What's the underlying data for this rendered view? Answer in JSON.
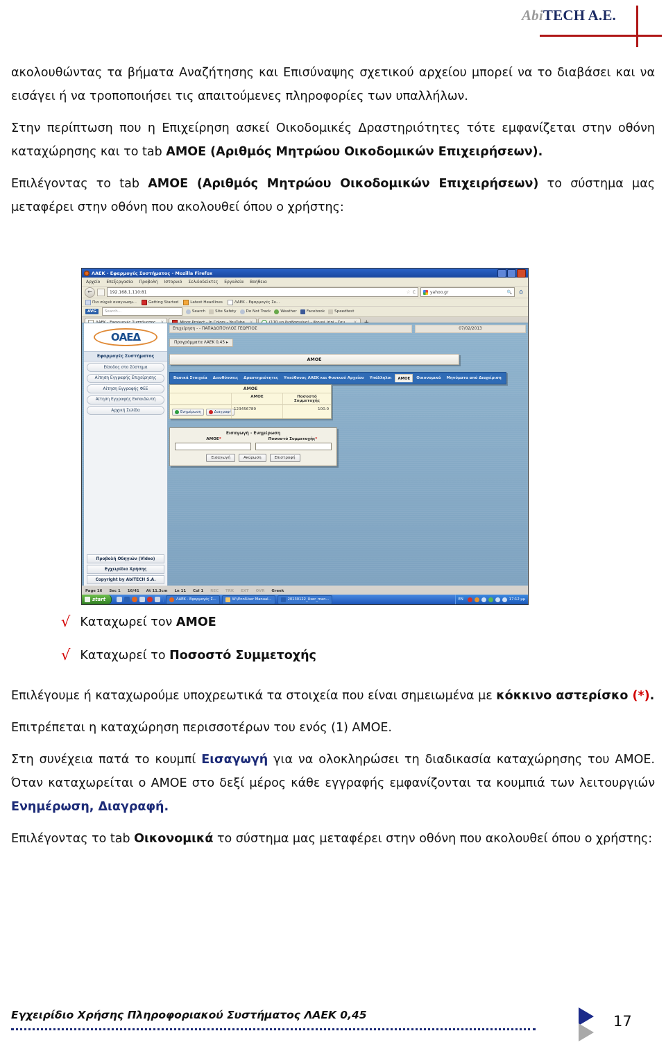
{
  "header": {
    "brand_abi": "Abi",
    "brand_tech": "TECH A.E."
  },
  "paragraphs": {
    "p1_a": "ακολουθώντας τα βήματα Αναζήτησης και Επισύναψης σχετικού αρχείου μπορεί να το διαβάσει και να εισάγει ή να τροποποιήσει τις απαιτούμενες πληροφορίες των υπαλλήλων.",
    "p2_a": " Στην περίπτωση που η Επιχείρηση ασκεί Οικοδομικές Δραστηριότητες τότε εμφανίζεται στην οθόνη καταχώρησης και το tab ",
    "p2_b": "ΑΜΟΕ (Αριθμός Μητρώου Οικοδομικών Επιχειρήσεων).",
    "p3_a": "Επιλέγοντας το tab ",
    "p3_b": "ΑΜΟΕ (Αριθμός Μητρώου Οικοδομικών Επιχειρήσεων)",
    "p3_c": " το σύστημα μας μεταφέρει στην οθόνη που ακολουθεί όπου ο χρήστης:",
    "p4_a": "Επιλέγουμε ή καταχωρούμε υποχρεωτικά τα στοιχεία που είναι σημειωμένα με ",
    "p4_b": "κόκκινο αστερίσκο ",
    "p4_c": "(*)",
    "p4_d": ".",
    "p5_a": "Επιτρέπεται η καταχώρηση περισσοτέρων του ενός (1) ΑΜΟΕ.",
    "p6_a": "Στη συνέχεια πατά το κουμπί ",
    "p6_b": "Εισαγωγή",
    "p6_c": " για να ολοκληρώσει τη διαδικασία καταχώρησης του ΑΜΟΕ. Όταν καταχωρείται ο ΑΜΟΕ στο δεξί μέρος κάθε εγγραφής εμφανίζονται τα κουμπιά των λειτουργιών ",
    "p6_d": "Ενημέρωση, Διαγραφή.",
    "p7_a": "Επιλέγοντας το tab ",
    "p7_b": "Οικονομικά",
    "p7_c": " το σύστημα μας μεταφέρει στην οθόνη που ακολουθεί όπου ο χρήστης:"
  },
  "bullets": [
    {
      "check": "√",
      "text_a": "Καταχωρεί τον ",
      "text_b": "ΑΜΟΕ"
    },
    {
      "check": "√",
      "text_a": "Καταχωρεί το ",
      "text_b": "Ποσοστό Συμμετοχής"
    }
  ],
  "screenshot": {
    "browser": {
      "window_title": "ΛΑΕΚ - Εφαρμογές Συστήματος - Mozilla Firefox",
      "menus": [
        "Αρχείο",
        "Επεξεργασία",
        "Προβολή",
        "Ιστορικό",
        "Σελιδοδείκτες",
        "Εργαλεία",
        "Βοήθεια"
      ],
      "url": "192.168.1.110:81",
      "reload_label": "C",
      "search_engine": "yahoo.gr",
      "bookmarks": [
        "Πιο σύχνά αναγνωσμ...",
        "Getting Started",
        "Latest Headlines",
        "ΛΑΕΚ - Εφαρμογές Συ..."
      ],
      "avg_label": "AVG",
      "avg_search_placeholder": "Search...",
      "avg_items": [
        "Search",
        "Site Safety",
        "Do Not Track",
        "Weather",
        "Facebook",
        "Speedtest"
      ],
      "tabs": [
        "ΛΑΕΚ - Εφαρμογές Συστήματος",
        "Minor Project - In Colors - YouTube",
        "(170 μη διαβασμένα) - ilkousi_irini - Γαμ...",
        "+"
      ]
    },
    "app": {
      "logo_text": "ΟΑΕΔ",
      "top_user": "Επιχείρηση - - ΠΑΠΑΔΟΠΟΥΛΟΣ ΓΕΩΡΓΙΟΣ",
      "top_date": "07/02/2013",
      "program_button": "Προγράμματα ΛΑΕΚ 0,45 ▸",
      "section_title": "ΑΜΟΕ",
      "sidebar": {
        "header": "Εφαρμογές Συστήματος",
        "items": [
          "Είσοδος στο Σύστημα",
          "Αίτηση Εγγραφής Επιχείρησης",
          "Αίτηση Εγγραφής ΦΕΕ",
          "Αίτηση Εγγραφής Εκπαιδευτή",
          "Αρχική Σελίδα"
        ],
        "footer": [
          "Προβολή Οδηγιών (Video)",
          "Εγχειρίδια Χρήσης",
          "Copyright by AbiTECH S.A."
        ]
      },
      "tabs": [
        {
          "label": "Βασικά Στοιχεία",
          "active": false
        },
        {
          "label": "Διευθύνσεις",
          "active": false
        },
        {
          "label": "Δραστηριότητες",
          "active": false
        },
        {
          "label": "Υπεύθυνος ΛΑΕΚ και Φυσικού Αρχείου",
          "active": false
        },
        {
          "label": "Υπάλληλοι",
          "active": false
        },
        {
          "label": "ΑΜΟΕ",
          "active": true
        },
        {
          "label": "Οικονομικά",
          "active": false
        },
        {
          "label": "Μηνύματα από Διαχείριση",
          "active": false
        }
      ],
      "table": {
        "title": "ΑΜΟΕ",
        "columns": [
          "",
          "ΑΜΟΕ",
          "Ποσοστό Συμμετοχής"
        ],
        "row_buttons": [
          "Ενημέρωση",
          "Διαγραφή"
        ],
        "rows": [
          {
            "amoe": "123456789",
            "pososto": "100.0"
          }
        ]
      },
      "form": {
        "title": "Εισαγωγή - Ενημέρωση",
        "field1_label": "ΑΜΟΕ",
        "field1_value": "",
        "field2_label": "Ποσοστό Συμμετοχής",
        "field2_value": "",
        "required_mark": "*",
        "buttons": [
          "Εισαγωγή",
          "Ακύρωση",
          "Επιστροφή"
        ]
      }
    },
    "word_status": [
      "Page 16",
      "Sec 1",
      "16/41",
      "At 11.3cm",
      "Ln 11",
      "Col 1",
      "REC",
      "TRK",
      "EXT",
      "OVR",
      "Greek"
    ],
    "taskbar": {
      "start": "start",
      "windows": [
        "ΛΑΕΚ - Εφαρμογές Σ...",
        "W:\\EnnlUser Manual...",
        "20130122_User_man..."
      ],
      "lang": "EN",
      "clock": "17:12 μμ"
    }
  },
  "footer": {
    "text": "Εγχειρίδιο Χρήσης Πληροφοριακού Συστήματος ΛΑΕΚ 0,45",
    "page_number": "17"
  }
}
